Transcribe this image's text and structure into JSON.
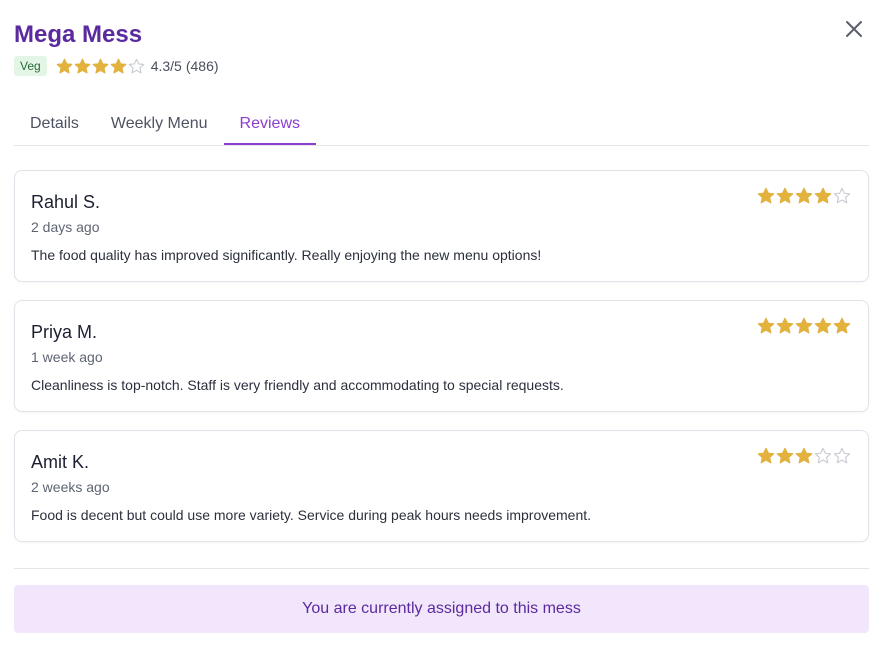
{
  "mess": {
    "name": "Mega Mess",
    "badge": "Veg",
    "rating": 4.3,
    "rating_label": "4.3/5",
    "review_count_label": "(486)"
  },
  "icons": {
    "close": "close-icon",
    "star": "star-icon"
  },
  "colors": {
    "accent": "#8a3fcf",
    "title": "#5b2a9e",
    "star_filled": "#e2b23c",
    "star_empty": "#c9ccd3"
  },
  "tabs": [
    {
      "label": "Details",
      "active": false
    },
    {
      "label": "Weekly Menu",
      "active": false
    },
    {
      "label": "Reviews",
      "active": true
    }
  ],
  "reviews": [
    {
      "name": "Rahul S.",
      "time": "2 days ago",
      "rating": 4,
      "text": "The food quality has improved significantly. Really enjoying the new menu options!"
    },
    {
      "name": "Priya M.",
      "time": "1 week ago",
      "rating": 5,
      "text": "Cleanliness is top-notch. Staff is very friendly and accommodating to special requests."
    },
    {
      "name": "Amit K.",
      "time": "2 weeks ago",
      "rating": 3,
      "text": "Food is decent but could use more variety. Service during peak hours needs improvement."
    }
  ],
  "banner": {
    "text": "You are currently assigned to this mess"
  }
}
